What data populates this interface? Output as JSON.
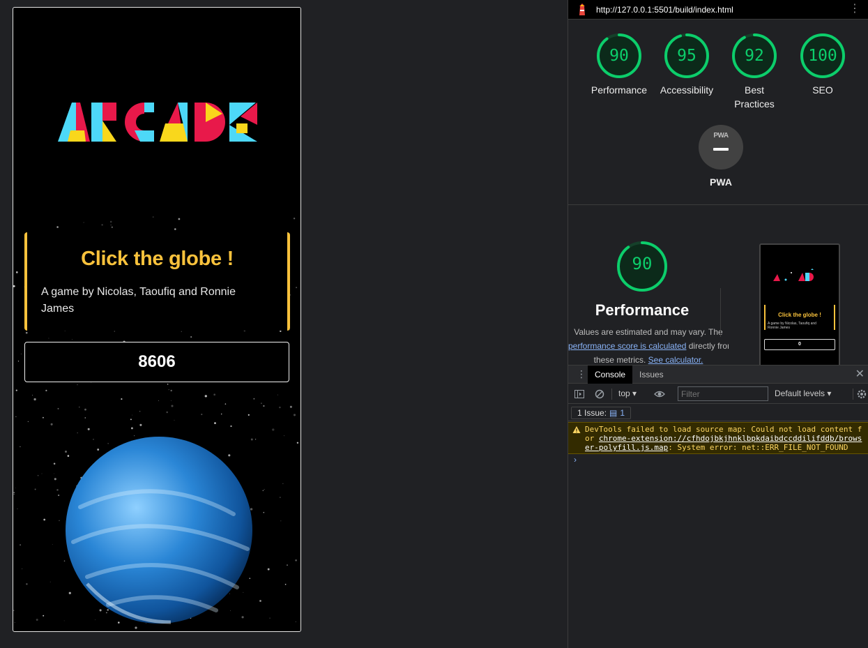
{
  "game": {
    "logo_text": "ARCADE",
    "title": "Click the globe !",
    "description": "A game by Nicolas, Taoufiq and Ronnie James",
    "score": "8606"
  },
  "devtools": {
    "url": "http://127.0.0.1:5501/build/index.html",
    "menu_icon": "⋮",
    "scores": [
      {
        "label": "Performance",
        "value": 90
      },
      {
        "label": "Accessibility",
        "value": 95
      },
      {
        "label": "Best Practices",
        "value": 92
      },
      {
        "label": "SEO",
        "value": 100
      }
    ],
    "pwa": {
      "badge": "PWA",
      "label": "PWA"
    },
    "performance": {
      "value": "90",
      "title": "Performance",
      "desc_1": "Values are estimated and may vary. The",
      "desc_link": "performance score is calculated",
      "desc_2": " directly from",
      "desc_3": "these metrics. ",
      "desc_link2": "See calculator."
    },
    "thumbnail": {
      "title": "Click the globe !",
      "desc": "A game by Nicolas, Taoufiq and Ronnie James",
      "score": "0"
    },
    "drawer": {
      "tab_console": "Console",
      "tab_issues": "Issues",
      "close": "✕",
      "context": "top ▾",
      "filter_placeholder": "Filter",
      "levels": "Default levels ▾",
      "issues_label": "1 Issue:",
      "issues_count": "1",
      "warning_1": "DevTools failed to load source map: Could not load content for ",
      "warning_link": "chrome-extension://cfhdojbkjhnklbpkdaibdccddilifddb/browser-polyfill.js.map",
      "warning_2": ": System error: net::ERR_FILE_NOT_FOUND",
      "prompt": "›"
    }
  },
  "colors": {
    "accent_yellow": "#f9c23c",
    "score_green": "#0cce6b",
    "link_blue": "#8ab4f8",
    "warning_text": "#fdd663"
  }
}
